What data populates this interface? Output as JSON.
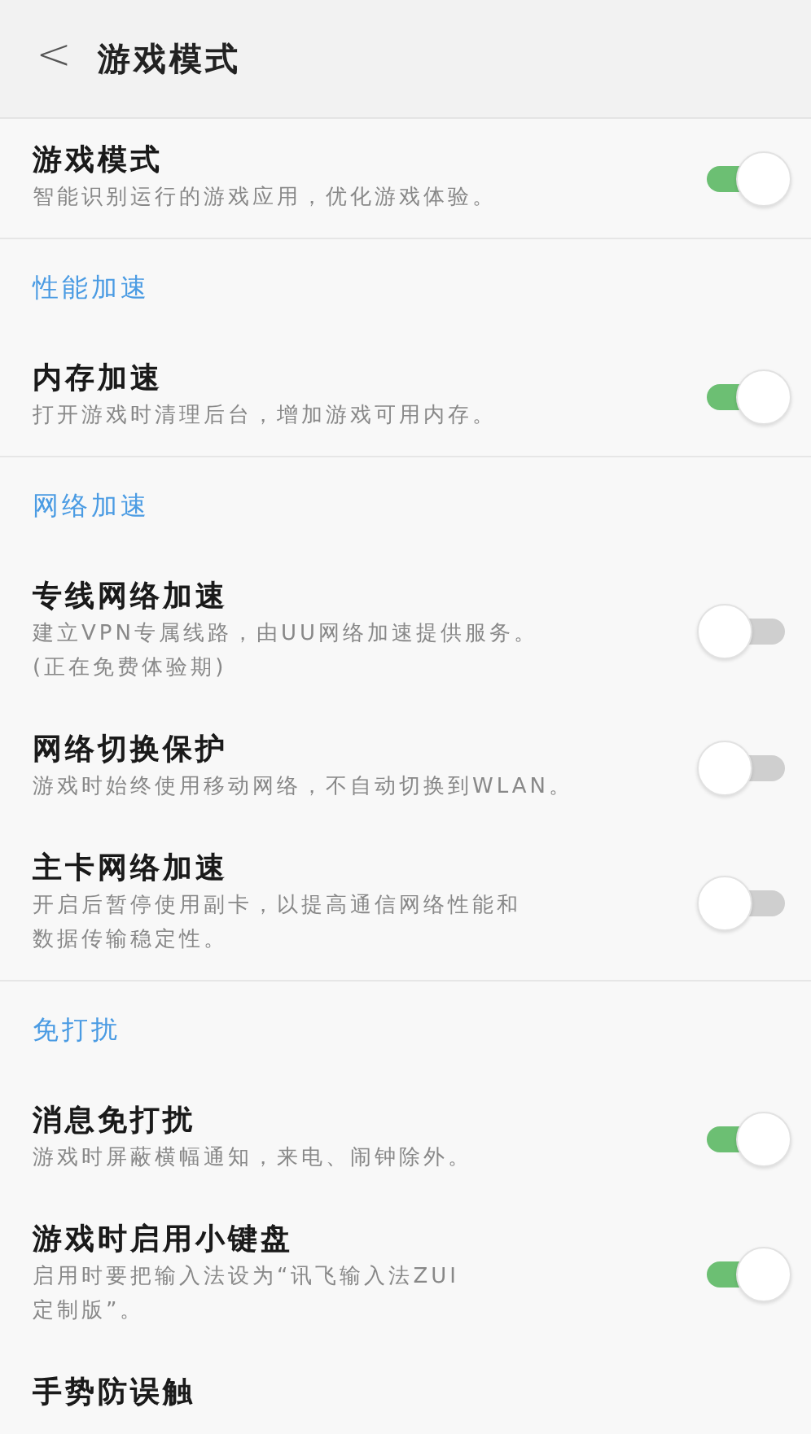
{
  "header": {
    "back": "<",
    "title": "游戏模式"
  },
  "sections": [
    {
      "items": [
        {
          "title": "游戏模式",
          "description": [
            "智能识别运行的游戏应用，优化游戏体验。"
          ],
          "on": true
        }
      ]
    },
    {
      "heading": "性能加速",
      "items": [
        {
          "title": "内存加速",
          "description": [
            "打开游戏时清理后台，增加游戏可用内存。"
          ],
          "on": true
        }
      ]
    },
    {
      "heading": "网络加速",
      "items": [
        {
          "title": "专线网络加速",
          "description": [
            "建立VPN专属线路，由UU网络加速提供服务。",
            "(正在免费体验期)"
          ],
          "on": false
        },
        {
          "title": "网络切换保护",
          "description": [
            "游戏时始终使用移动网络，不自动切换到WLAN。"
          ],
          "on": false
        },
        {
          "title": "主卡网络加速",
          "description": [
            "开启后暂停使用副卡，以提高通信网络性能和",
            "数据传输稳定性。"
          ],
          "on": false
        }
      ]
    },
    {
      "heading": "免打扰",
      "items": [
        {
          "title": "消息免打扰",
          "description": [
            "游戏时屏蔽横幅通知，来电、闹钟除外。"
          ],
          "on": true
        },
        {
          "title": "游戏时启用小键盘",
          "description": [
            "启用时要把输入法设为“讯飞输入法ZUI",
            "定制版”。"
          ],
          "on": true
        },
        {
          "title": "手势防误触"
        }
      ]
    }
  ]
}
